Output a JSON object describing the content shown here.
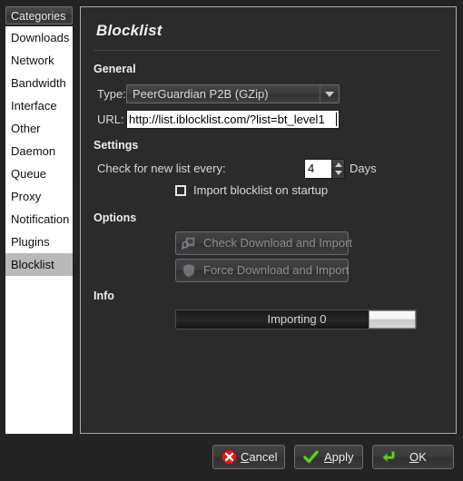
{
  "window": {
    "background_color": "#232323"
  },
  "sidebar": {
    "header": "Categories",
    "selected": "Blocklist",
    "items": [
      {
        "label": "Downloads"
      },
      {
        "label": "Network"
      },
      {
        "label": "Bandwidth"
      },
      {
        "label": "Interface"
      },
      {
        "label": "Other"
      },
      {
        "label": "Daemon"
      },
      {
        "label": "Queue"
      },
      {
        "label": "Proxy"
      },
      {
        "label": "Notification"
      },
      {
        "label": "Plugins"
      },
      {
        "label": "Blocklist"
      }
    ]
  },
  "panel": {
    "title": "Blocklist",
    "general": {
      "heading": "General",
      "type_label": "Type:",
      "type_value": "PeerGuardian P2B (GZip)",
      "url_label": "URL:",
      "url_value": "http://list.iblocklist.com/?list=bt_level1"
    },
    "settings": {
      "heading": "Settings",
      "check_interval_label": "Check for new list every:",
      "check_interval_value": "4",
      "check_interval_unit": "Days",
      "import_on_startup_label": "Import blocklist on startup",
      "import_on_startup_checked": false
    },
    "options": {
      "heading": "Options",
      "check_download_label": "Check Download and Import",
      "force_download_label": "Force Download and Import",
      "buttons_enabled": false
    },
    "info": {
      "heading": "Info",
      "progress_text": "Importing 0"
    }
  },
  "dialog_buttons": {
    "cancel": {
      "label_pre": "",
      "accel": "C",
      "label_post": "ancel",
      "icon_color": "#d42020"
    },
    "apply": {
      "label_pre": "",
      "accel": "A",
      "label_post": "pply",
      "icon_color": "#5bbd23"
    },
    "ok": {
      "label_pre": "",
      "accel": "O",
      "label_post": "K",
      "icon_color": "#5bbd23"
    }
  }
}
